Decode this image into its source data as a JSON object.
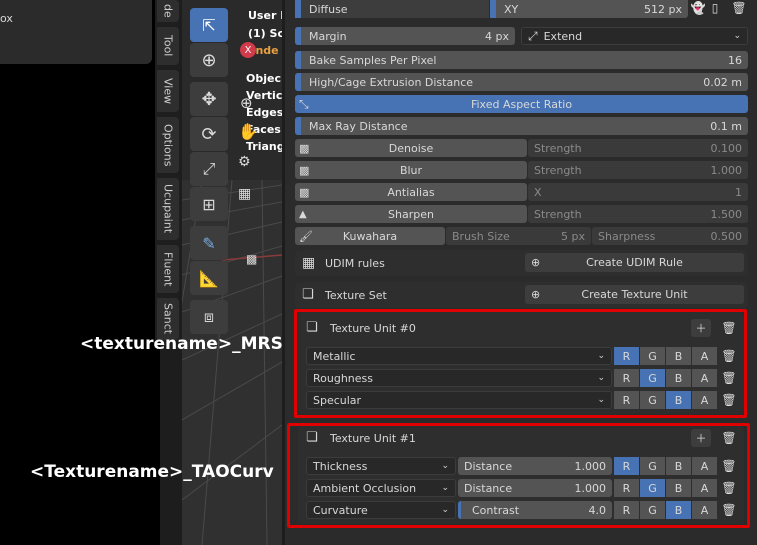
{
  "left_panel": {
    "item": "ox"
  },
  "sidebar_tabs": [
    "de",
    "Tool",
    "View",
    "Options",
    "Ucupaint",
    "Fluent",
    "Sanct"
  ],
  "viewport_overlay": {
    "line1": "User P",
    "line2": "(1) Sc",
    "line3": "ende",
    "stats": [
      "Objec",
      "Vertic",
      "Edges",
      "Faces",
      "Triang"
    ]
  },
  "bake": {
    "top_row": {
      "name": "Diffuse",
      "mode": "XY",
      "size": "512 px"
    },
    "margin": {
      "label": "Margin",
      "value": "4 px",
      "mode": "Extend"
    },
    "samples": {
      "label": "Bake Samples Per Pixel",
      "value": "16"
    },
    "cage": {
      "label": "High/Cage Extrusion Distance",
      "value": "0.02 m"
    },
    "aspect": {
      "label": "Fixed Aspect Ratio"
    },
    "ray": {
      "label": "Max Ray Distance",
      "value": "0.1 m"
    },
    "filters": [
      {
        "name": "Denoise",
        "param": "Strength",
        "value": "0.100"
      },
      {
        "name": "Blur",
        "param": "Strength",
        "value": "1.000"
      },
      {
        "name": "Antialias",
        "param": "X",
        "value": "1"
      },
      {
        "name": "Sharpen",
        "param": "Strength",
        "value": "1.500"
      }
    ],
    "kuwahara": {
      "name": "Kuwahara",
      "p1": "Brush Size",
      "v1": "5 px",
      "p2": "Sharpness",
      "v2": "0.500"
    },
    "udim": {
      "label": "UDIM rules",
      "button": "Create UDIM Rule"
    },
    "texset": {
      "label": "Texture Set",
      "button": "Create Texture Unit"
    }
  },
  "units": [
    {
      "title": "Texture Unit #0",
      "annotation": "<texturename>_MRS",
      "channels": [
        {
          "name": "Metallic",
          "active": "R"
        },
        {
          "name": "Roughness",
          "active": "G"
        },
        {
          "name": "Specular",
          "active": "B"
        }
      ]
    },
    {
      "title": "Texture Unit #1",
      "annotation": "<Texturename>_TAOCurv",
      "channels": [
        {
          "name": "Thickness",
          "param": "Distance",
          "value": "1.000",
          "active": "R"
        },
        {
          "name": "Ambient Occlusion",
          "param": "Distance",
          "value": "1.000",
          "active": "G"
        },
        {
          "name": "Curvature",
          "param": "Contrast",
          "value": "4.0",
          "active": "B"
        }
      ]
    }
  ],
  "rgba": [
    "R",
    "G",
    "B",
    "A"
  ]
}
